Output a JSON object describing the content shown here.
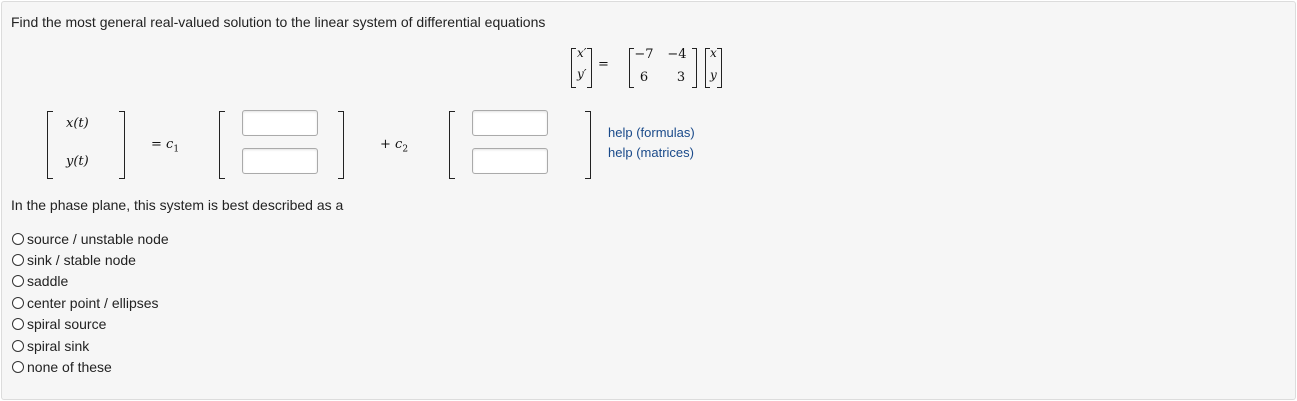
{
  "problem": {
    "prompt": "Find the most general real-valued solution to the linear system of differential equations"
  },
  "system": {
    "lhs_top": "x′",
    "lhs_bottom": "y′",
    "equals": "=",
    "matrix": [
      "−7",
      "−4",
      "6",
      "3"
    ],
    "vec_top": "x",
    "vec_bottom": "y"
  },
  "solution": {
    "x_label": "x(t)",
    "y_label": "y(t)",
    "eq_c1": "= c",
    "c1_sub": "1",
    "plus_c2": "+ c",
    "c2_sub": "2",
    "inputs": {
      "v1_top": "",
      "v1_bottom": "",
      "v2_top": "",
      "v2_bottom": ""
    }
  },
  "help": {
    "formulas": "help (formulas)",
    "matrices": "help (matrices)"
  },
  "question": {
    "prompt": "In the phase plane, this system is best described as a",
    "options": [
      "source / unstable node",
      "sink / stable node",
      "saddle",
      "center point / ellipses",
      "spiral source",
      "spiral sink",
      "none of these"
    ]
  }
}
